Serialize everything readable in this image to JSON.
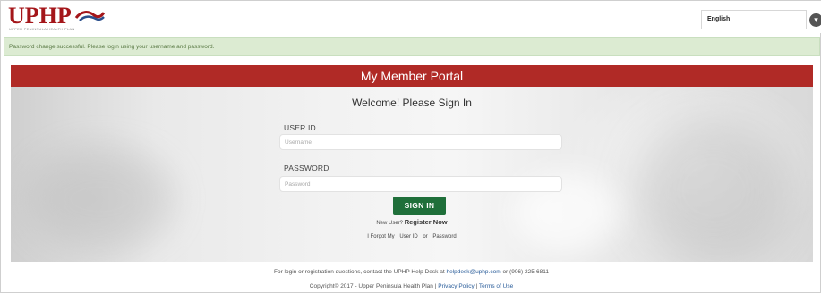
{
  "header": {
    "logo_text": "UPHP",
    "logo_tagline": "UPPER PENINSULA HEALTH PLAN",
    "language_selected": "English"
  },
  "alert": {
    "message": "Password change successful. Please login using your username and password."
  },
  "portal": {
    "title": "My Member Portal",
    "welcome": "Welcome! Please Sign In",
    "userid_label": "USER ID",
    "userid_placeholder": "Username",
    "password_label": "PASSWORD",
    "password_placeholder": "Password",
    "signin_label": "SIGN IN",
    "new_user_text": "New User?",
    "register_label": "Register Now",
    "forgot_prefix": "I Forgot My",
    "forgot_userid": "User ID",
    "forgot_or": "or",
    "forgot_password": "Password"
  },
  "footer": {
    "help_text_prefix": "For login or registration questions, contact the UPHP Help Desk at",
    "help_email": "helpdesk@uphp.com",
    "help_text_or": "or",
    "help_phone": "(906) 225-6811",
    "copyright": "Copyright© 2017 - Upper Peninsula Health Plan",
    "separator": "|",
    "privacy_label": "Privacy Policy",
    "terms_label": "Terms of Use"
  },
  "colors": {
    "brand_red": "#b02a26",
    "signin_green": "#1f6f3a",
    "alert_bg": "#dcebd2"
  }
}
